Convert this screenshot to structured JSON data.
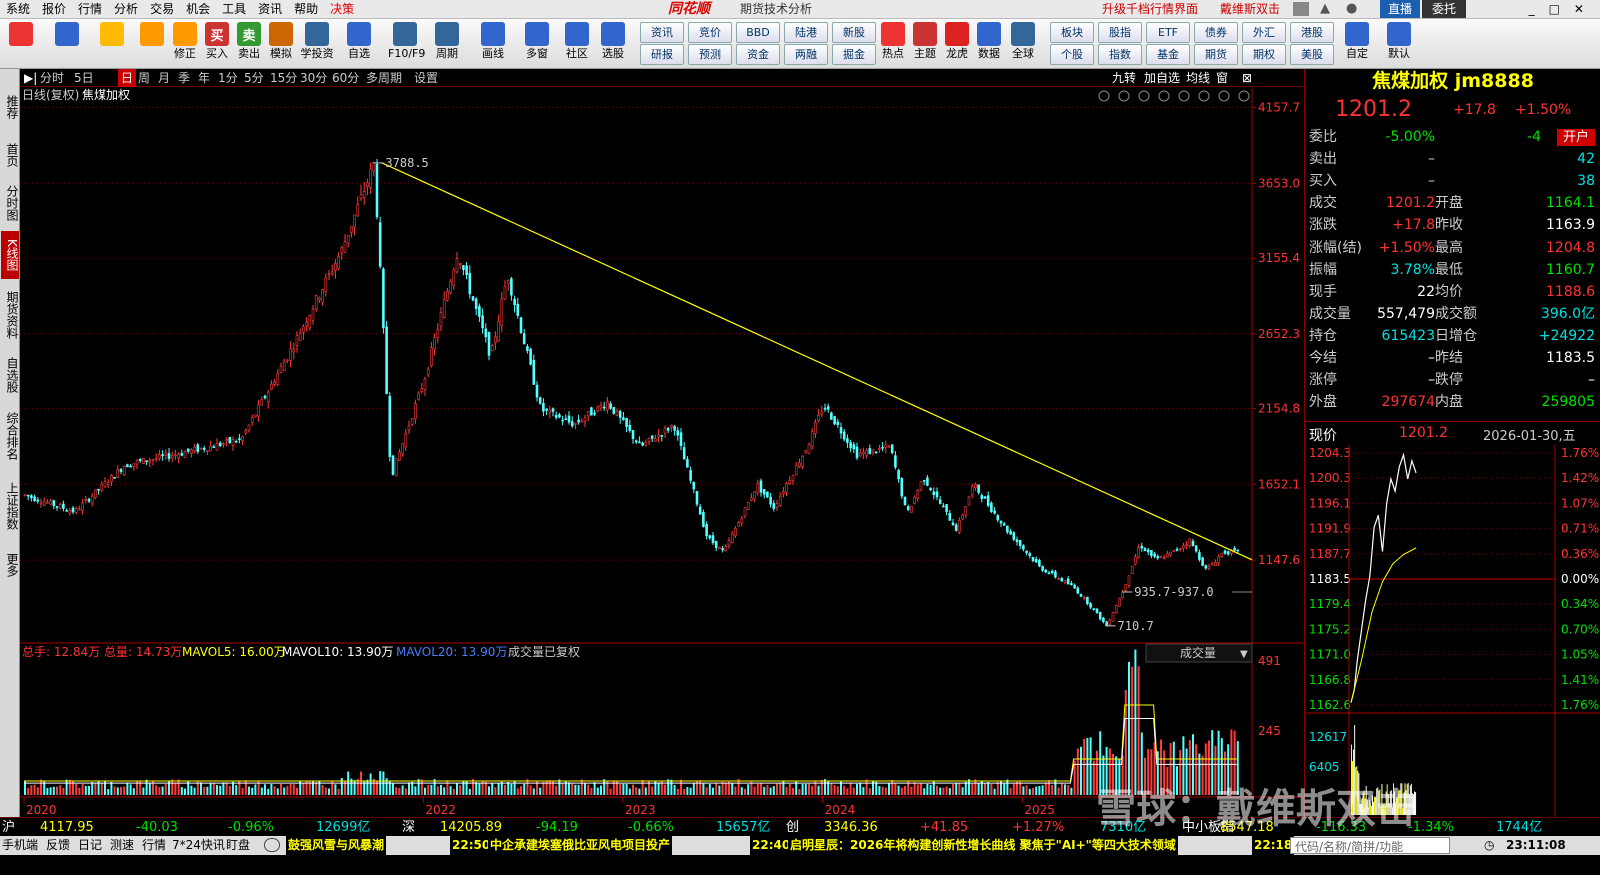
{
  "menu": [
    "系统",
    "报价",
    "行情",
    "分析",
    "交易",
    "机会",
    "工具",
    "资讯",
    "帮助",
    "决策"
  ],
  "app_logo": "同花顺",
  "app_title": "期货技术分析",
  "links": [
    "升级千档行情界面",
    "戴维斯双击"
  ],
  "window_buttons": [
    "直播",
    "委托"
  ],
  "toolbar": {
    "big": [
      {
        "icon": "grid-icon",
        "label": ""
      },
      {
        "icon": "ai-icon",
        "label": ""
      },
      {
        "icon": "back-arrow-icon",
        "label": ""
      },
      {
        "icon": "up-down-arrow-icon",
        "label": ""
      },
      {
        "icon": "modify-icon",
        "label": "修正"
      },
      {
        "icon": "buy-icon",
        "label": "买入",
        "glyph": "买"
      },
      {
        "icon": "sell-icon",
        "label": "卖出",
        "glyph": "卖"
      },
      {
        "icon": "simulate-icon",
        "label": "模拟"
      },
      {
        "icon": "learn-icon",
        "label": "学投资"
      },
      {
        "icon": "watchlist-icon",
        "label": "自选"
      },
      {
        "icon": "f10-icon",
        "label": "F10/F9"
      },
      {
        "icon": "period-icon",
        "label": "周期"
      },
      {
        "icon": "draw-icon",
        "label": "画线"
      },
      {
        "icon": "multiwin-icon",
        "label": "多窗"
      },
      {
        "icon": "community-icon",
        "label": "社区"
      },
      {
        "icon": "select-stock-icon",
        "label": "选股"
      }
    ],
    "small_top": [
      "资讯",
      "竞价",
      "BBD",
      "陆港",
      "新股"
    ],
    "small_bot": [
      "研报",
      "预测",
      "资金",
      "两融",
      "掘金"
    ],
    "big2": [
      {
        "icon": "hot-icon",
        "label": "热点"
      },
      {
        "icon": "theme-icon",
        "label": "主题"
      },
      {
        "icon": "dragon-icon",
        "label": "龙虎"
      },
      {
        "icon": "data-icon",
        "label": "数据"
      },
      {
        "icon": "global-icon",
        "label": "全球"
      }
    ],
    "small2_top": [
      "板块",
      "股指",
      "ETF",
      "债券",
      "外汇",
      "港股"
    ],
    "small2_bot": [
      "个股",
      "指数",
      "基金",
      "期货",
      "期权",
      "美股"
    ],
    "big3": [
      {
        "icon": "custom-icon",
        "label": "自定"
      },
      {
        "icon": "home-icon",
        "label": "默认"
      }
    ]
  },
  "leftnav": [
    "推荐",
    "首页",
    "分时图",
    "K线图",
    "期货资料",
    "自选股",
    "综合排名",
    "上证指数",
    "更多"
  ],
  "periods": [
    "分时",
    "5日",
    "日",
    "周",
    "月",
    "季",
    "年",
    "1分",
    "5分",
    "15分",
    "30分",
    "60分",
    "多周期",
    "设置"
  ],
  "period_active": "日",
  "chart_tools": [
    "九转",
    "加自选",
    "均线",
    "窗"
  ],
  "chart_header": [
    "日线(复权)",
    "焦煤加权"
  ],
  "chart_data": {
    "type": "candlestick",
    "title": "焦煤加权",
    "price_axis": [
      "4157.7",
      "3653.0",
      "3155.4",
      "2652.3",
      "2154.8",
      "1652.1",
      "1147.6"
    ],
    "price_range": [
      650,
      4200
    ],
    "x_labels": [
      "2020",
      "2022",
      "2023",
      "2024",
      "2025"
    ],
    "annotations": [
      "3788.5",
      "935.7-937.0",
      "710.7"
    ],
    "trend_line": {
      "from": {
        "date": "2021-11",
        "price": 3788.5
      },
      "to": {
        "date": "2026-01",
        "price": 1150
      }
    },
    "swing_points": [
      [
        "2020-01",
        1580
      ],
      [
        "2020-04",
        1470
      ],
      [
        "2020-07",
        1780
      ],
      [
        "2020-10",
        1850
      ],
      [
        "2021-02",
        1950
      ],
      [
        "2021-05",
        2550
      ],
      [
        "2021-08",
        3200
      ],
      [
        "2021-10",
        3788.5
      ],
      [
        "2021-11",
        1700
      ],
      [
        "2022-01",
        2350
      ],
      [
        "2022-03",
        3200
      ],
      [
        "2022-05",
        2500
      ],
      [
        "2022-06",
        3050
      ],
      [
        "2022-08",
        2150
      ],
      [
        "2022-10",
        2050
      ],
      [
        "2022-12",
        2200
      ],
      [
        "2023-02",
        1900
      ],
      [
        "2023-04",
        2050
      ],
      [
        "2023-06",
        1300
      ],
      [
        "2023-07",
        1200
      ],
      [
        "2023-09",
        1650
      ],
      [
        "2023-10",
        1500
      ],
      [
        "2023-12",
        1900
      ],
      [
        "2024-01",
        2180
      ],
      [
        "2024-03",
        1850
      ],
      [
        "2024-05",
        1900
      ],
      [
        "2024-06",
        1450
      ],
      [
        "2024-07",
        1700
      ],
      [
        "2024-09",
        1350
      ],
      [
        "2024-10",
        1650
      ],
      [
        "2024-11",
        1500
      ],
      [
        "2024-12",
        1350
      ],
      [
        "2025-02",
        1100
      ],
      [
        "2025-04",
        970
      ],
      [
        "2025-05",
        850
      ],
      [
        "2025-06",
        710.7
      ],
      [
        "2025-07",
        950
      ],
      [
        "2025-08",
        1250
      ],
      [
        "2025-09",
        1150
      ],
      [
        "2025-10",
        1200
      ],
      [
        "2025-11",
        1280
      ],
      [
        "2025-12",
        1080
      ],
      [
        "2026-01",
        1201.2
      ]
    ],
    "volume_axis": [
      "491",
      "245"
    ],
    "volume_legend": {
      "total_hands": "总手: 12.84万",
      "total_vol": "总量: 14.73万",
      "ma5": "MAVOL5: 16.00万",
      "ma10": "MAVOL10: 13.90万",
      "ma20": "MAVOL20: 13.90万",
      "note": "成交量已复权",
      "selector": "成交量"
    }
  },
  "quote": {
    "name": "焦煤加权",
    "code": "jm8888",
    "price": "1201.2",
    "change": "+17.8",
    "pct": "+1.50%",
    "rows": [
      {
        "k": "委比",
        "v": "-5.00%",
        "k2": "",
        "v2": "-4",
        "btn": "开户"
      },
      {
        "k": "卖出",
        "v": "–",
        "v2": "42"
      },
      {
        "k": "买入",
        "v": "–",
        "v2": "38"
      },
      {
        "k": "成交",
        "v": "1201.2",
        "k2": "开盘",
        "v2": "1164.1"
      },
      {
        "k": "涨跌",
        "v": "+17.8",
        "k2": "昨收",
        "v2": "1163.9"
      },
      {
        "k": "涨幅(结)",
        "v": "+1.50%",
        "k2": "最高",
        "v2": "1204.8"
      },
      {
        "k": "振幅",
        "v": "3.78%",
        "k2": "最低",
        "v2": "1160.7"
      },
      {
        "k": "现手",
        "v": "22",
        "k2": "均价",
        "v2": "1188.6"
      },
      {
        "k": "成交量",
        "v": "557,479",
        "k2": "成交额",
        "v2": "396.0亿"
      },
      {
        "k": "持仓",
        "v": "615423",
        "k2": "日增仓",
        "v2": "+24922"
      },
      {
        "k": "今结",
        "v": "–",
        "k2": "昨结",
        "v2": "1183.5"
      },
      {
        "k": "涨停",
        "v": "–",
        "k2": "跌停",
        "v2": "–"
      },
      {
        "k": "外盘",
        "v": "297674",
        "k2": "内盘",
        "v2": "259805"
      }
    ],
    "intraday_title": "现价",
    "intraday_price": "1201.2",
    "intraday_date": "2026-01-30,五",
    "intraday_left": [
      "1204.3",
      "1200.3",
      "1196.1",
      "1191.9",
      "1187.7",
      "1183.5",
      "1179.4",
      "1175.2",
      "1171.0",
      "1166.8",
      "1162.6"
    ],
    "intraday_right": [
      "1.76%",
      "1.42%",
      "1.07%",
      "0.71%",
      "0.36%",
      "0.00%",
      "0.34%",
      "0.70%",
      "1.05%",
      "1.41%",
      "1.76%"
    ],
    "intraday_vol": [
      "12617",
      "6405"
    ]
  },
  "indexbar": [
    {
      "n": "沪",
      "p": "4117.95",
      "c": "-40.03",
      "pc": "-0.96%",
      "a": "12699亿"
    },
    {
      "n": "深",
      "p": "14205.89",
      "c": "-94.19",
      "pc": "-0.66%",
      "a": "15657亿"
    },
    {
      "n": "创",
      "p": "3346.36",
      "c": "+41.85",
      "pc": "+1.27%",
      "a": "7310亿"
    },
    {
      "n": "中小板指",
      "p": "8547.18",
      "c": "-116.33",
      "pc": "-1.34%",
      "a": "1744亿"
    }
  ],
  "status": {
    "items": [
      "手机端",
      "反馈",
      "日记",
      "测速",
      "行情",
      "7*24快讯",
      "盯盘"
    ],
    "news": [
      {
        "t": "",
        "s": "鼓强风雪与风暴潮"
      },
      {
        "t": "22:50",
        "s": "中企承建埃塞俄比亚风电项目投产"
      },
      {
        "t": "22:40",
        "s": "启明星辰：2026年将构建创新性增长曲线 聚焦于\"AI+\"等四大技术领域"
      },
      {
        "t": "22:18",
        "s": ""
      }
    ],
    "search_placeholder": "代码/名称/简拼/功能",
    "clock": "23:11:08"
  },
  "watermark": "雪球：戴维斯双击"
}
